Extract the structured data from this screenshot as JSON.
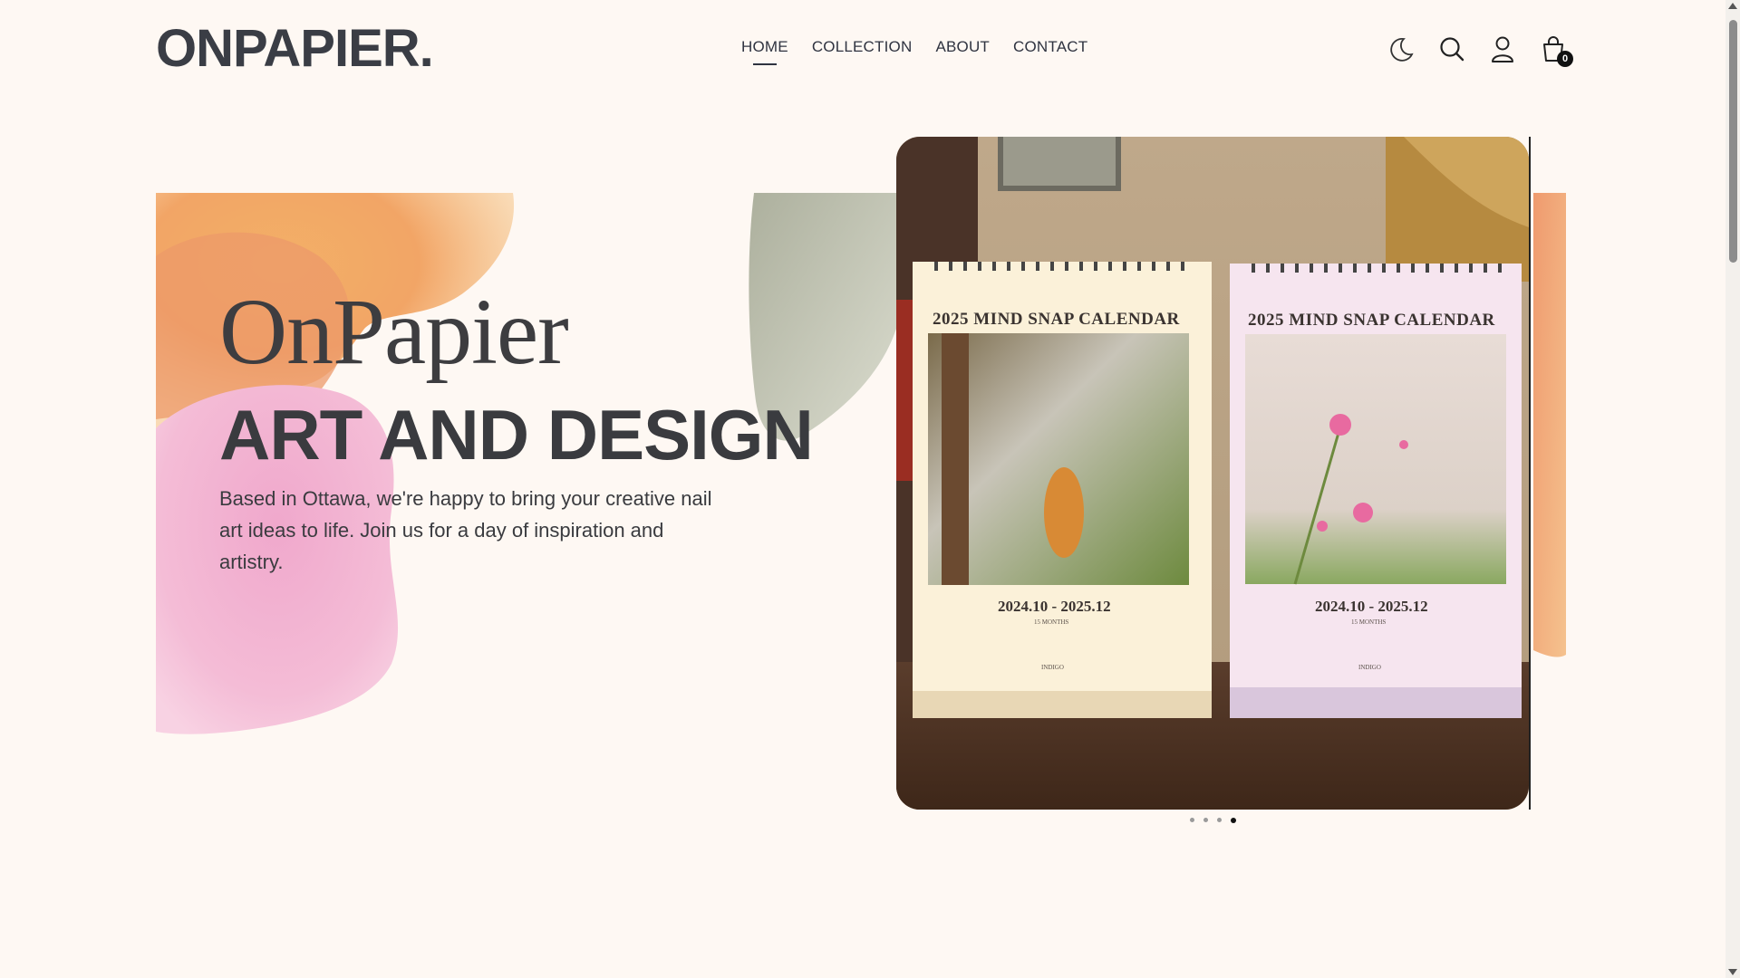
{
  "header": {
    "logo": "ONPAPIER.",
    "nav": [
      {
        "label": "HOME",
        "active": true
      },
      {
        "label": "COLLECTION",
        "active": false
      },
      {
        "label": "ABOUT",
        "active": false
      },
      {
        "label": "CONTACT",
        "active": false
      }
    ],
    "icons": [
      "moon-icon",
      "search-icon",
      "user-icon",
      "shopping-bag-icon"
    ],
    "cart_count": "0"
  },
  "hero": {
    "title": "OnPapier",
    "subtitle": "ART AND DESIGN",
    "description": "Based in Ottawa, we're happy to bring your creative nail art ideas to life. Join us for a day of inspiration and artistry."
  },
  "slider": {
    "calendars": [
      {
        "title": "2025 MIND SNAP CALENDAR",
        "dates": "2024.10 - 2025.12",
        "months": "15 MONTHS",
        "brand": "INDIGO"
      },
      {
        "title": "2025 MIND SNAP CALENDAR",
        "dates": "2024.10 - 2025.12",
        "months": "15 MONTHS",
        "brand": "INDIGO"
      }
    ],
    "slide_count": 4,
    "active_slide": 4
  },
  "colors": {
    "background": "#fef8f3",
    "text": "#3a3d45",
    "watercolor_orange": "#f0a55a",
    "watercolor_pink": "#f2b6d3",
    "watercolor_green": "#a9ae9a"
  }
}
